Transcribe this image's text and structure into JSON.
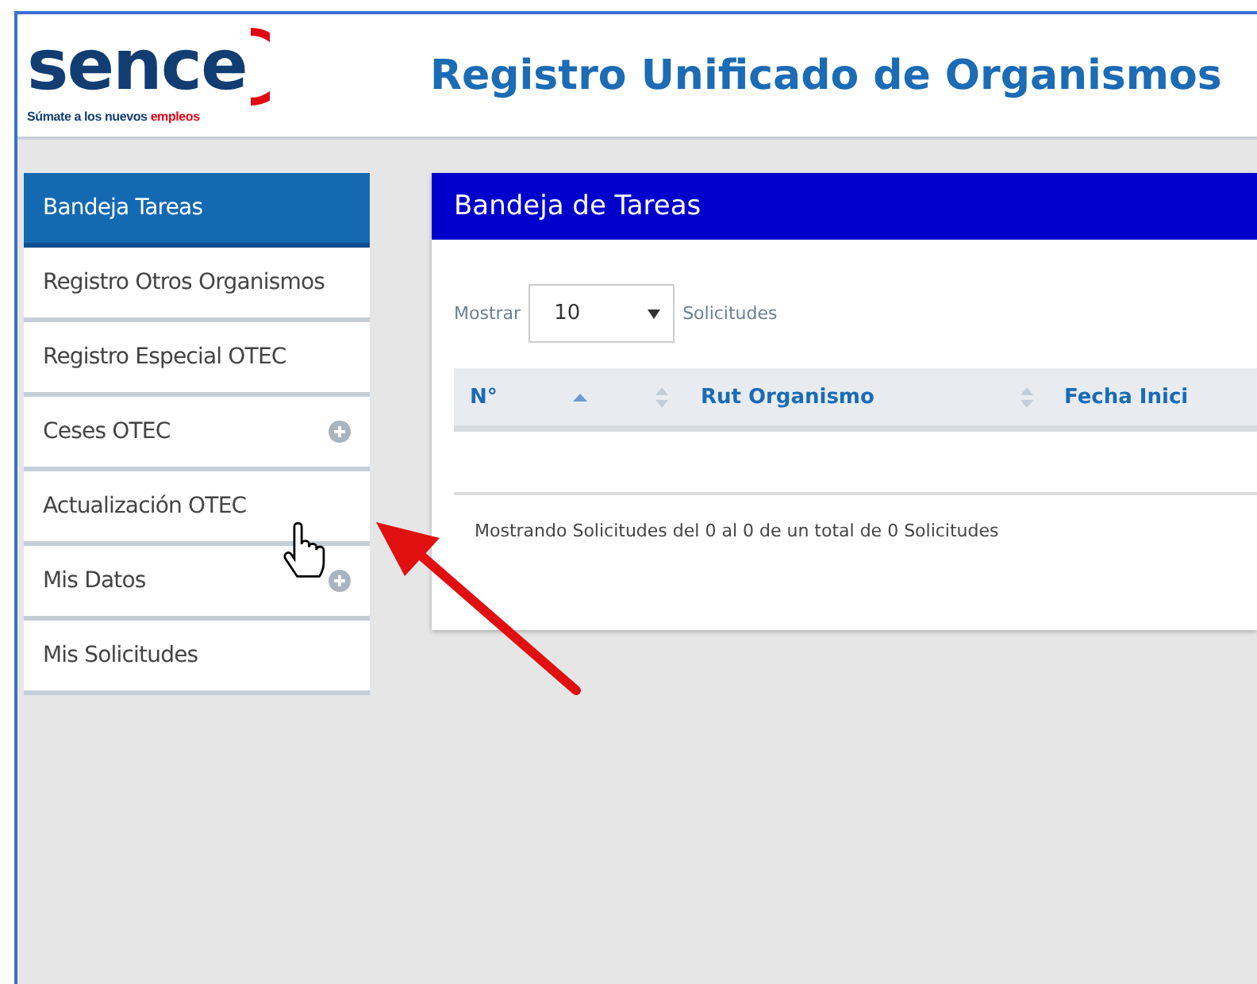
{
  "logo": {
    "wordmark": "sence",
    "tagline": "Súmate a los nuevos",
    "tagline_accent": "empleos"
  },
  "header": {
    "title": "Registro Unificado de Organismos"
  },
  "sidebar": {
    "items": [
      {
        "label": "Bandeja Tareas",
        "selected": true,
        "kind": "link"
      },
      {
        "label": "Registro Otros Organismos",
        "selected": false,
        "kind": "link"
      },
      {
        "label": "Registro Especial OTEC",
        "selected": false,
        "kind": "link"
      },
      {
        "label": "Ceses OTEC",
        "selected": false,
        "kind": "expandable"
      },
      {
        "label": "Actualización OTEC",
        "selected": false,
        "kind": "link"
      },
      {
        "label": "Mis Datos",
        "selected": false,
        "kind": "expandable"
      },
      {
        "label": "Mis Solicitudes",
        "selected": false,
        "kind": "link"
      }
    ]
  },
  "panel": {
    "title": "Bandeja de Tareas",
    "length": {
      "before": "Mostrar",
      "value": "10",
      "after": "Solicitudes"
    },
    "table": {
      "columns": [
        {
          "label": "N°",
          "sorted_ascending": true,
          "sortable": true
        },
        {
          "label": "Rut Organismo",
          "sorted_ascending": false,
          "sortable": true
        },
        {
          "label": "Fecha Inici",
          "sorted_ascending": false,
          "sortable": false
        }
      ]
    },
    "info": "Mostrando Solicitudes del 0 al 0 de un total de 0 Solicitudes"
  }
}
